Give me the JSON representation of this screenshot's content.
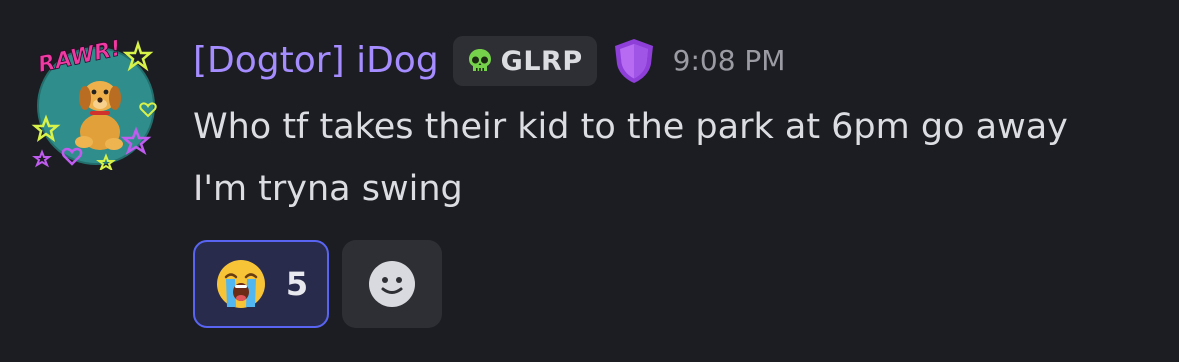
{
  "message": {
    "username": "[Dogtor] iDog",
    "guild_tag": {
      "icon": "skull-icon",
      "text": "GLRP"
    },
    "badge_icon": "shield-badge-icon",
    "timestamp": "9:08 PM",
    "content": "Who tf takes their kid to the park at 6pm go away I'm tryna swing",
    "avatar": {
      "icon": "dog-avatar",
      "text": "RAWR!"
    }
  },
  "reactions": [
    {
      "emoji": "loudly-crying-face",
      "count": "5",
      "reacted": true
    }
  ],
  "add_reaction": {
    "icon": "smiley-add-reaction-icon"
  },
  "colors": {
    "background": "#1c1d22",
    "username": "#a58cff",
    "reaction_border": "#5965f2",
    "reaction_bg": "#292b4c",
    "chip_bg": "#2e2f35"
  }
}
